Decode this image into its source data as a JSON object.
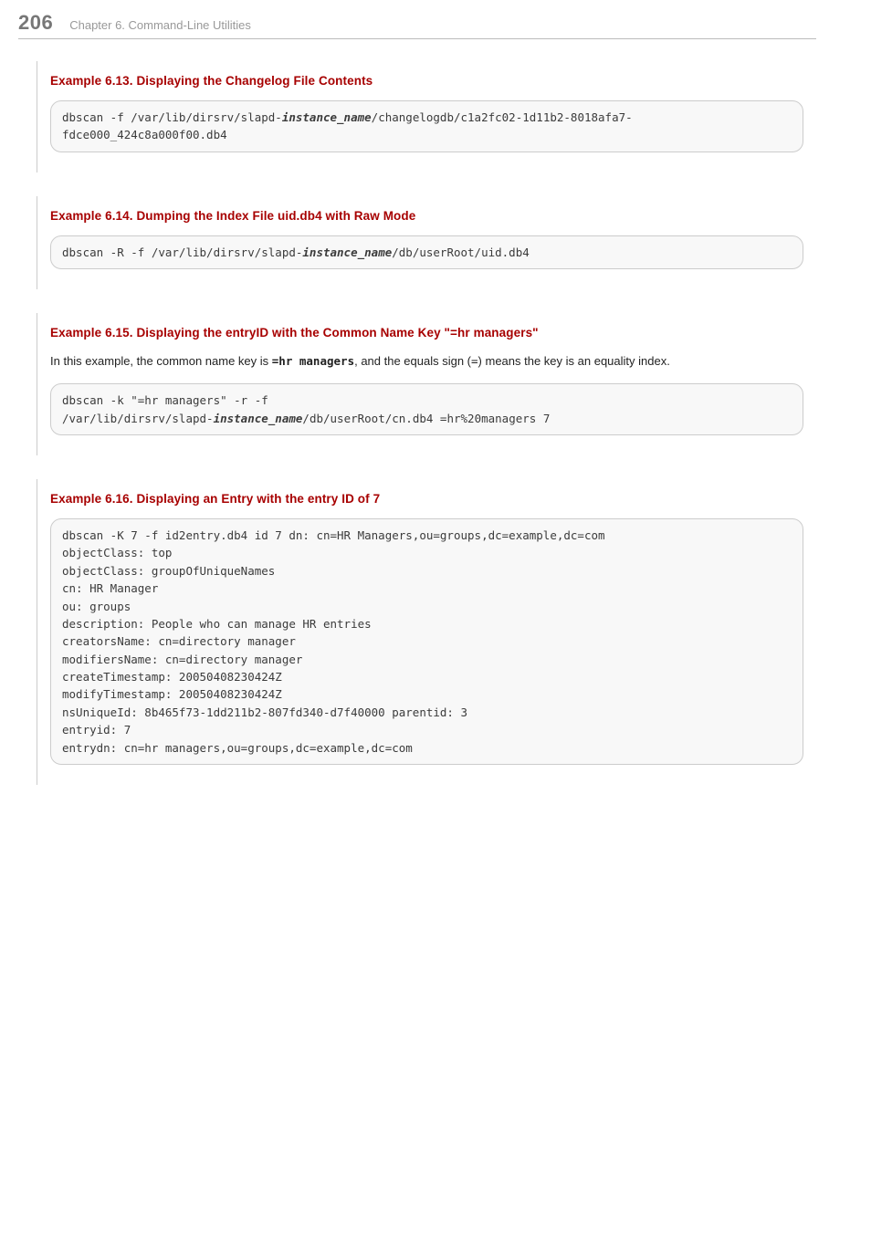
{
  "header": {
    "pageno": "206",
    "chapter": "Chapter 6. Command-Line Utilities"
  },
  "ex13": {
    "title": "Example 6.13. Displaying the Changelog File Contents",
    "code_pre": "dbscan -f /var/lib/dirsrv/slapd-",
    "code_inst": "instance_name",
    "code_post": "/changelogdb/c1a2fc02-1d11b2-8018afa7-fdce000_424c8a000f00.db4"
  },
  "ex14": {
    "title": "Example 6.14. Dumping the Index File uid.db4 with Raw Mode",
    "code_pre": "dbscan -R -f /var/lib/dirsrv/slapd-",
    "code_inst": "instance_name",
    "code_post": "/db/userRoot/uid.db4"
  },
  "ex15": {
    "title": "Example 6.15. Displaying the entryID with the Common Name Key \"=hr managers\"",
    "para_a": "In this example, the common name key is ",
    "para_bold": "=hr managers",
    "para_b": ", and the equals sign (",
    "para_mono": "=",
    "para_c": ") means the key is an equality index.",
    "code_pre": "dbscan -k \"=hr managers\" -r -f\n/var/lib/dirsrv/slapd-",
    "code_inst": "instance_name",
    "code_post": "/db/userRoot/cn.db4 =hr%20managers 7"
  },
  "ex16": {
    "title": "Example 6.16. Displaying an Entry with the entry ID of 7",
    "code": "dbscan -K 7 -f id2entry.db4 id 7 dn: cn=HR Managers,ou=groups,dc=example,dc=com\nobjectClass: top\nobjectClass: groupOfUniqueNames\ncn: HR Manager\nou: groups\ndescription: People who can manage HR entries\ncreatorsName: cn=directory manager\nmodifiersName: cn=directory manager\ncreateTimestamp: 20050408230424Z\nmodifyTimestamp: 20050408230424Z\nnsUniqueId: 8b465f73-1dd211b2-807fd340-d7f40000 parentid: 3\nentryid: 7\nentrydn: cn=hr managers,ou=groups,dc=example,dc=com"
  }
}
